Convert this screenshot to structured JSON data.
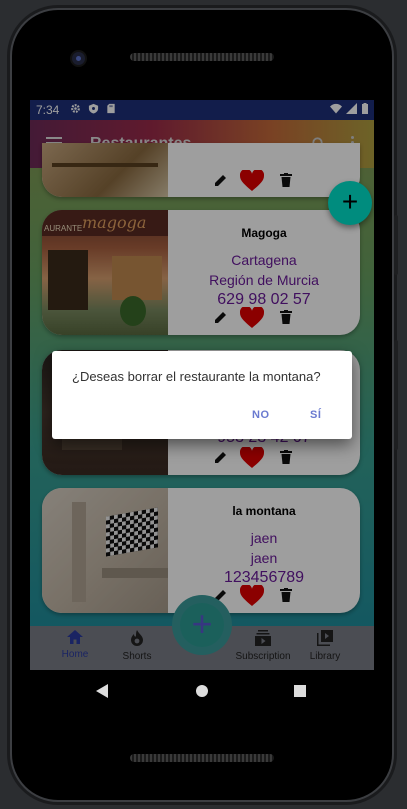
{
  "status_bar": {
    "time": "7:34"
  },
  "app_bar": {
    "title": "Restaurantes",
    "menu_icon": "menu-icon",
    "search_icon": "search-icon",
    "more_icon": "more-vert-icon"
  },
  "restaurants": [
    {
      "name": "",
      "line1": "",
      "line2": "",
      "phone": ""
    },
    {
      "name": "Magoga",
      "line1": "Cartagena",
      "line2": "Región de Murcia",
      "phone": "629 98 02 57",
      "sign_text": "magoga",
      "sign_text2": "AURANTE"
    },
    {
      "name": "",
      "line1": "",
      "line2": "",
      "phone": "953 23 42 07"
    },
    {
      "name": "la montana",
      "line1": "jaen",
      "line2": "jaen",
      "phone": "123456789"
    }
  ],
  "dialog": {
    "message": "¿Deseas borrar el restaurante la montana?",
    "no_label": "NO",
    "yes_label": "SÍ"
  },
  "fab": {
    "label": "+"
  },
  "bottom_nav": [
    {
      "label": "Home",
      "icon": "home-icon",
      "active": true
    },
    {
      "label": "Shorts",
      "icon": "flame-icon",
      "active": false
    },
    {
      "label": "Subscription",
      "icon": "subscriptions-icon",
      "active": false
    },
    {
      "label": "Library",
      "icon": "library-icon",
      "active": false
    }
  ],
  "colors": {
    "accent": "#6a1b9a",
    "fab": "#008c7e",
    "status_bar": "#1e2f7a",
    "dialog_button": "#6a7ad0"
  }
}
